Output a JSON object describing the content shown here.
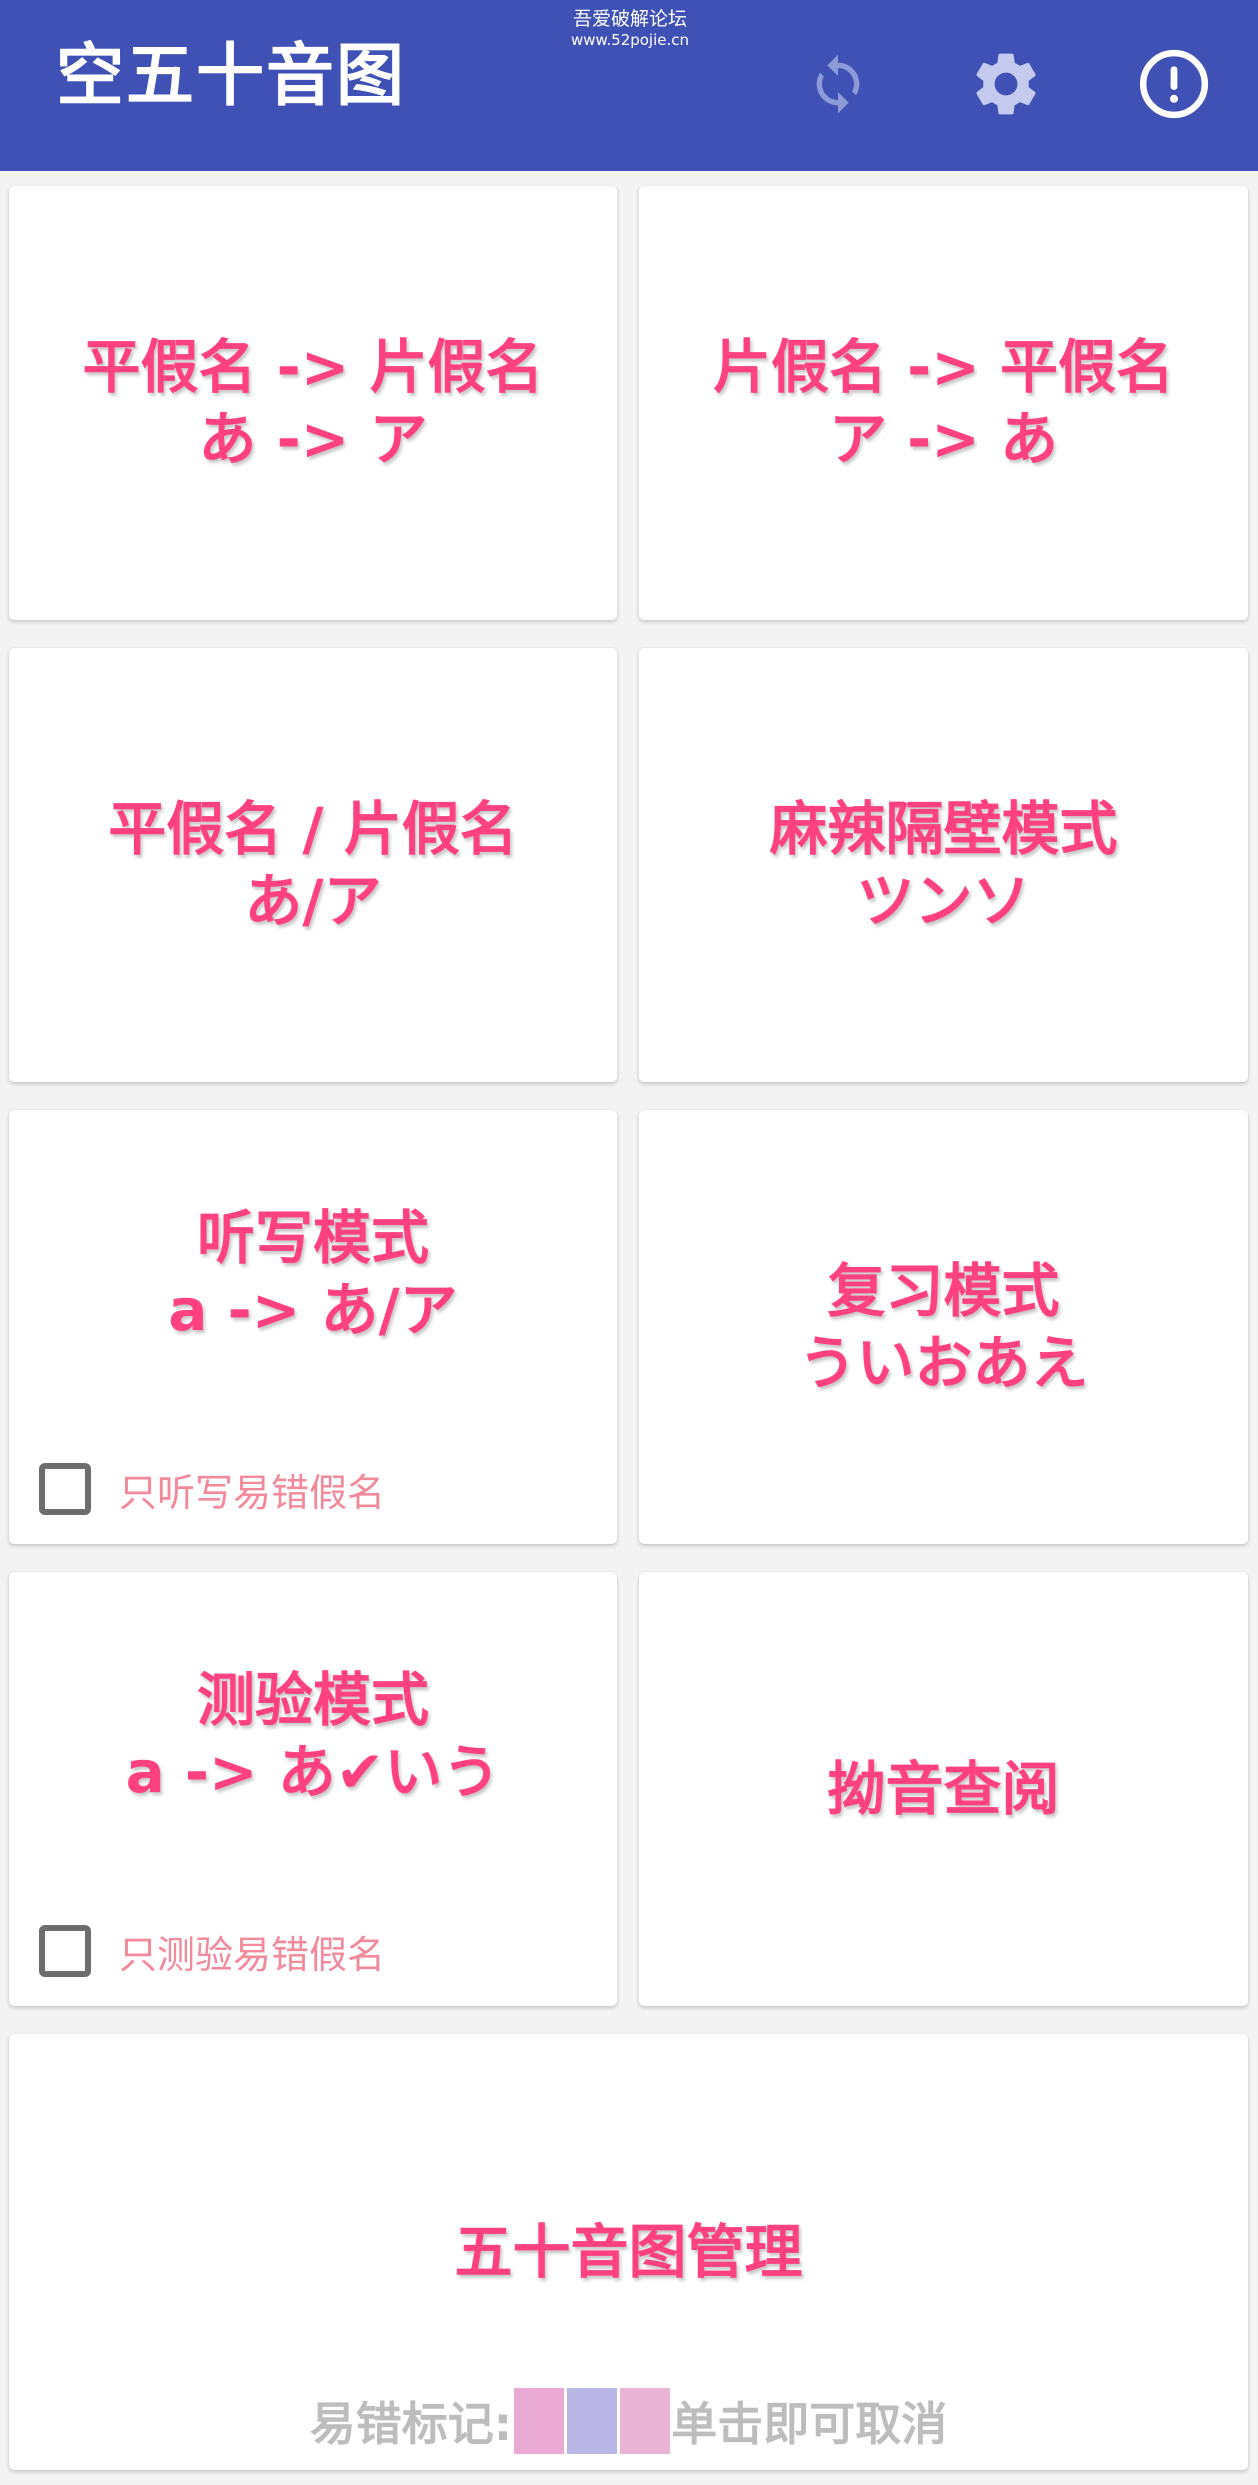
{
  "app": {
    "title": "空五十音图",
    "watermark_line1": "吾爱破解论坛",
    "watermark_line2": "www.52pojie.cn"
  },
  "toolbar": {
    "refresh_icon": "refresh-icon",
    "settings_icon": "gear-icon",
    "info_icon": "alert-circle-icon"
  },
  "colors": {
    "appbar": "#3f51b5",
    "accent_text": "#ff4081",
    "checkbox_label": "#f28a9c",
    "legend_text": "#bdbdbd",
    "swatch1": "#e9a9d3",
    "swatch2": "#b9b6e6",
    "swatch3": "#e9b4d6"
  },
  "cards": {
    "hira_to_kata": {
      "line1": "平假名 -> 片假名",
      "line2": "あ -> ア"
    },
    "kata_to_hira": {
      "line1": "片假名 -> 平假名",
      "line2": "ア -> あ"
    },
    "hira_kata": {
      "line1": "平假名 / 片假名",
      "line2": "あ/ア"
    },
    "tricky": {
      "line1": "麻辣隔壁模式",
      "line2": "ツンソ"
    },
    "dictation": {
      "line1": "听写模式",
      "line2": "a -> あ/ア",
      "checkbox_label": "只听写易错假名"
    },
    "review": {
      "line1": "复习模式",
      "line2": "ういおあえ"
    },
    "quiz": {
      "line1": "测验模式",
      "line2": "a -> あ✔いう",
      "checkbox_label": "只测验易错假名"
    },
    "youon": {
      "line1": "拗音查阅"
    },
    "manage": {
      "line1": "五十音图管理",
      "legend_prefix": "易错标记:",
      "legend_suffix": "单击即可取消"
    }
  }
}
